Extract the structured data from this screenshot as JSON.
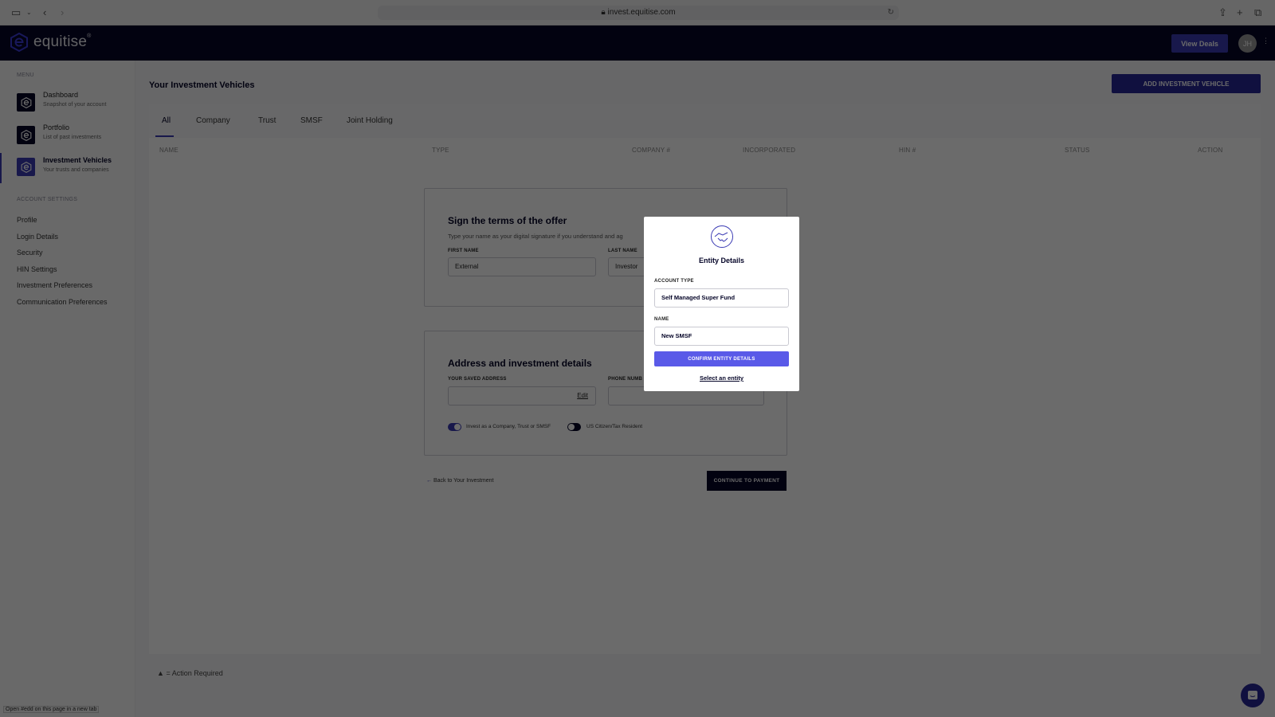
{
  "browser": {
    "url": "invest.equitise.com",
    "status_tip": "Open #edd on this page in a new tab"
  },
  "topnav": {
    "brand": "equitise",
    "brand_mark": "®",
    "view_deals_label": "View Deals",
    "avatar_initials": "JH"
  },
  "sidebar": {
    "menu_heading": "MENU",
    "items": [
      {
        "label": "Dashboard",
        "sub": "Snapshot of your account",
        "active": false
      },
      {
        "label": "Portfolio",
        "sub": "List of past investments",
        "active": false
      },
      {
        "label": "Investment Vehicles",
        "sub": "Your trusts and companies",
        "active": true
      }
    ],
    "settings_heading": "ACCOUNT SETTINGS",
    "settings": [
      "Profile",
      "Login Details",
      "Security",
      "HIN Settings",
      "Investment Preferences",
      "Communication Preferences"
    ]
  },
  "main": {
    "title": "Your Investment Vehicles",
    "add_button": "ADD INVESTMENT VEHICLE",
    "tabs": [
      "All",
      "Company",
      "Trust",
      "SMSF",
      "Joint Holding"
    ],
    "active_tab": "All",
    "columns": [
      "NAME",
      "TYPE",
      "COMPANY #",
      "INCORPORATED",
      "HIN #",
      "STATUS",
      "ACTION"
    ],
    "legend": "= Action Required"
  },
  "sign_panel": {
    "title": "Sign the terms of the offer",
    "subtitle": "Type your name as your digital signature if you understand and ag",
    "first_name_label": "FIRST NAME",
    "first_name_value": "External",
    "last_name_label": "LAST NAME",
    "last_name_value": "Investor"
  },
  "address_panel": {
    "title": "Address and investment details",
    "address_label": "YOUR SAVED ADDRESS",
    "address_value": "",
    "edit_label": "Edit",
    "phone_label": "PHONE NUMB",
    "phone_value": "",
    "toggle_company_label": "Invest as a Company, Trust or SMSF",
    "toggle_company_on": true,
    "toggle_us_label": "US Citizen/Tax Resident",
    "toggle_us_on": false
  },
  "actions": {
    "back_label": "Back to Your Investment",
    "continue_label": "CONTINUE TO PAYMENT"
  },
  "modal": {
    "title": "Entity Details",
    "account_type_label": "ACCOUNT TYPE",
    "account_type_value": "Self Managed Super Fund",
    "name_label": "NAME",
    "name_value": "New SMSF",
    "confirm_label": "CONFIRM ENTITY DETAILS",
    "select_label": "Select an entity"
  },
  "colors": {
    "brand_navy": "#050528",
    "accent": "#3b3bb4",
    "confirm": "#5a5ae8"
  }
}
